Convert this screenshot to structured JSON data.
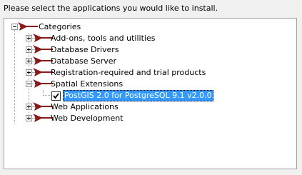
{
  "instruction": "Please select the applications you would like to install.",
  "tree": {
    "root": {
      "label": "Categories",
      "expanded": true,
      "icon": "red-pennant-icon"
    },
    "categories": [
      {
        "label": "Add-ons, tools and utilities",
        "expanded": false,
        "icon": "red-pennant-icon"
      },
      {
        "label": "Database Drivers",
        "expanded": false,
        "icon": "red-pennant-icon"
      },
      {
        "label": "Database Server",
        "expanded": false,
        "icon": "red-pennant-icon"
      },
      {
        "label": "Registration-required and trial products",
        "expanded": false,
        "icon": "red-pennant-icon"
      },
      {
        "label": "Spatial Extensions",
        "expanded": true,
        "icon": "red-pennant-icon",
        "children": [
          {
            "label": "PostGIS 2.0 for PostgreSQL 9.1 v2.0.0",
            "checked": true,
            "selected": true
          }
        ]
      },
      {
        "label": "Web Applications",
        "expanded": false,
        "icon": "red-pennant-icon"
      },
      {
        "label": "Web Development",
        "expanded": false,
        "icon": "red-pennant-icon"
      }
    ]
  },
  "colors": {
    "selection": "#3399ff",
    "pennant": "#8b1a1a",
    "background": "#f0f0f0"
  }
}
